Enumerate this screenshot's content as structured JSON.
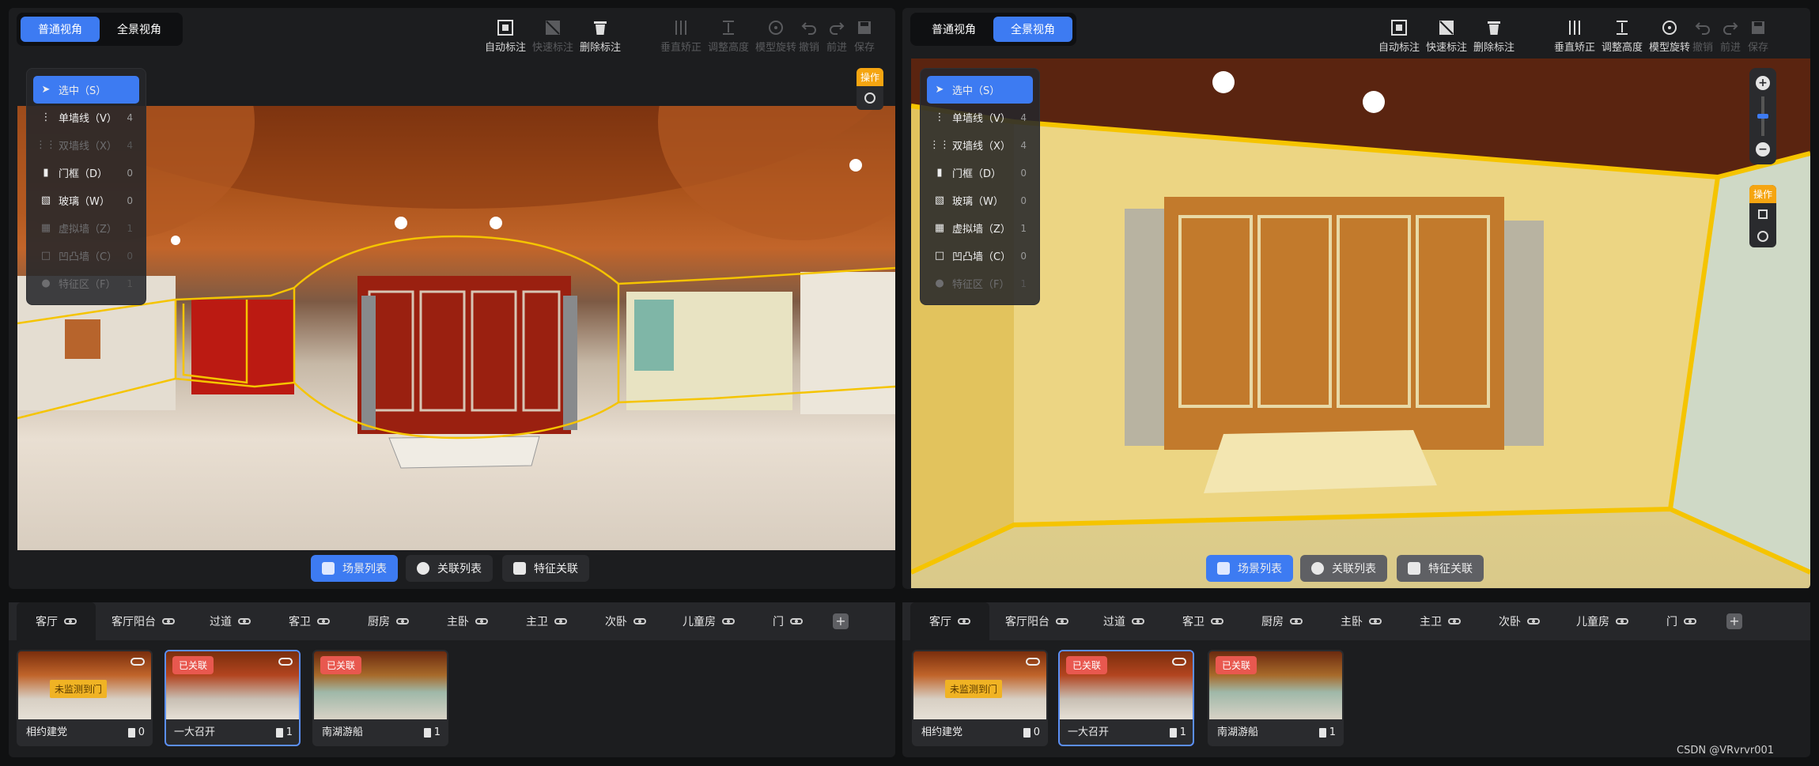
{
  "view_modes": {
    "normal": "普通视角",
    "panorama": "全景视角"
  },
  "toolbar": {
    "auto_mark": "自动标注",
    "quick_mark": "快速标注",
    "delete_mark": "删除标注",
    "vertical_correct": "垂直矫正",
    "adjust_height": "调整高度",
    "rotate_model": "模型旋转",
    "undo": "撤销",
    "redo": "前进",
    "save": "保存"
  },
  "tools": [
    {
      "label": "选中（S）",
      "count": "",
      "icon": "cursor-icon"
    },
    {
      "label": "单墙线（V）",
      "count": "4",
      "icon": "single-wall-icon"
    },
    {
      "label": "双墙线（X）",
      "count": "4",
      "icon": "double-wall-icon"
    },
    {
      "label": "门框（D）",
      "count": "0",
      "icon": "door-frame-icon"
    },
    {
      "label": "玻璃（W）",
      "count": "0",
      "icon": "glass-icon"
    },
    {
      "label": "虚拟墙（Z）",
      "count": "1",
      "icon": "virtual-wall-icon"
    },
    {
      "label": "凹凸墙（C）",
      "count": "0",
      "icon": "concave-wall-icon"
    },
    {
      "label": "特征区（F）",
      "count": "1",
      "icon": "feature-area-icon"
    }
  ],
  "operate_label": "操作",
  "bottom_buttons": {
    "scene_list": "场景列表",
    "link_list": "关联列表",
    "feature_link": "特征关联"
  },
  "room_tabs": [
    "客厅",
    "客厅阳台",
    "过道",
    "客卫",
    "厨房",
    "主卧",
    "主卫",
    "次卧",
    "儿童房",
    "门"
  ],
  "add_label": "+",
  "scenes": [
    {
      "name": "相约建党",
      "count": "0",
      "badge": "未监测到门",
      "badge_type": "warning"
    },
    {
      "name": "一大召开",
      "count": "1",
      "badge": "已关联",
      "badge_type": "linked"
    },
    {
      "name": "南湖游船",
      "count": "1",
      "badge": "已关联",
      "badge_type": "linked"
    }
  ],
  "watermark": "CSDN @VRvrvr001",
  "colors": {
    "accent": "#3d7bf2",
    "outline": "#f5c400",
    "badge_red": "#e8584f",
    "badge_yellow": "#f0b324"
  }
}
